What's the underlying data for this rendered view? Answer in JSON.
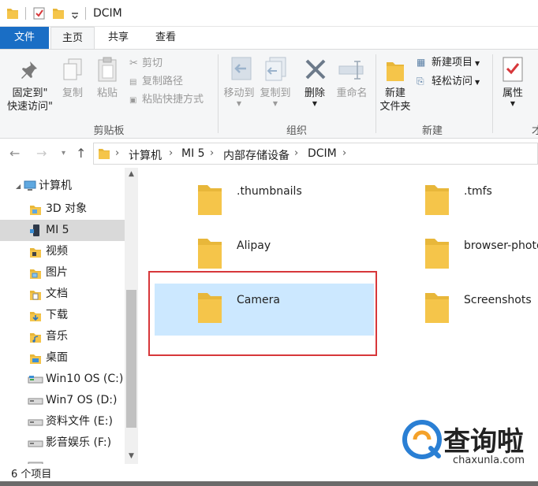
{
  "window": {
    "title": "DCIM"
  },
  "tabs": {
    "file": "文件",
    "home": "主页",
    "share": "共享",
    "view": "查看"
  },
  "ribbon": {
    "pin_line1": "固定到\"",
    "pin_line2": "快速访问\"",
    "copy": "复制",
    "paste": "粘贴",
    "cut": "剪切",
    "copy_path": "复制路径",
    "paste_shortcut": "粘贴快捷方式",
    "group_clipboard": "剪贴板",
    "move_to": "移动到",
    "copy_to": "复制到",
    "delete": "删除",
    "rename": "重命名",
    "group_organize": "组织",
    "new_folder_line1": "新建",
    "new_folder_line2": "文件夹",
    "new_item": "新建项目",
    "easy_access": "轻松访问",
    "group_new": "新建",
    "properties": "属性",
    "group_open_partial": "才"
  },
  "address": {
    "crumbs": [
      "计算机",
      "MI 5",
      "内部存储设备",
      "DCIM"
    ]
  },
  "sidebar": {
    "items": [
      {
        "label": "计算机",
        "icon": "computer-icon"
      },
      {
        "label": "3D 对象",
        "icon": "3d-objects-icon"
      },
      {
        "label": "MI 5",
        "icon": "phone-icon",
        "selected": true
      },
      {
        "label": "视频",
        "icon": "video-folder-icon"
      },
      {
        "label": "图片",
        "icon": "pictures-folder-icon"
      },
      {
        "label": "文档",
        "icon": "documents-folder-icon"
      },
      {
        "label": "下载",
        "icon": "downloads-folder-icon"
      },
      {
        "label": "音乐",
        "icon": "music-folder-icon"
      },
      {
        "label": "桌面",
        "icon": "desktop-folder-icon"
      },
      {
        "label": "Win10 OS (C:)",
        "icon": "drive-icon"
      },
      {
        "label": "Win7 OS (D:)",
        "icon": "drive-icon"
      },
      {
        "label": "资料文件 (E:)",
        "icon": "drive-icon"
      },
      {
        "label": "影音娱乐 (F:)",
        "icon": "drive-icon"
      }
    ]
  },
  "files": [
    {
      "name": ".thumbnails"
    },
    {
      "name": ".tmfs"
    },
    {
      "name": "Alipay"
    },
    {
      "name": "browser-photo"
    },
    {
      "name": "Camera",
      "selected": true
    },
    {
      "name": "Screenshots"
    }
  ],
  "status": {
    "count": "6 个项目"
  },
  "watermark": {
    "text": "查询啦",
    "url": "chaxunla.com"
  },
  "colors": {
    "accent": "#1a6ec5",
    "selection": "#cce8ff",
    "highlight_box": "#d7373a",
    "folder": "#f5c54a"
  }
}
